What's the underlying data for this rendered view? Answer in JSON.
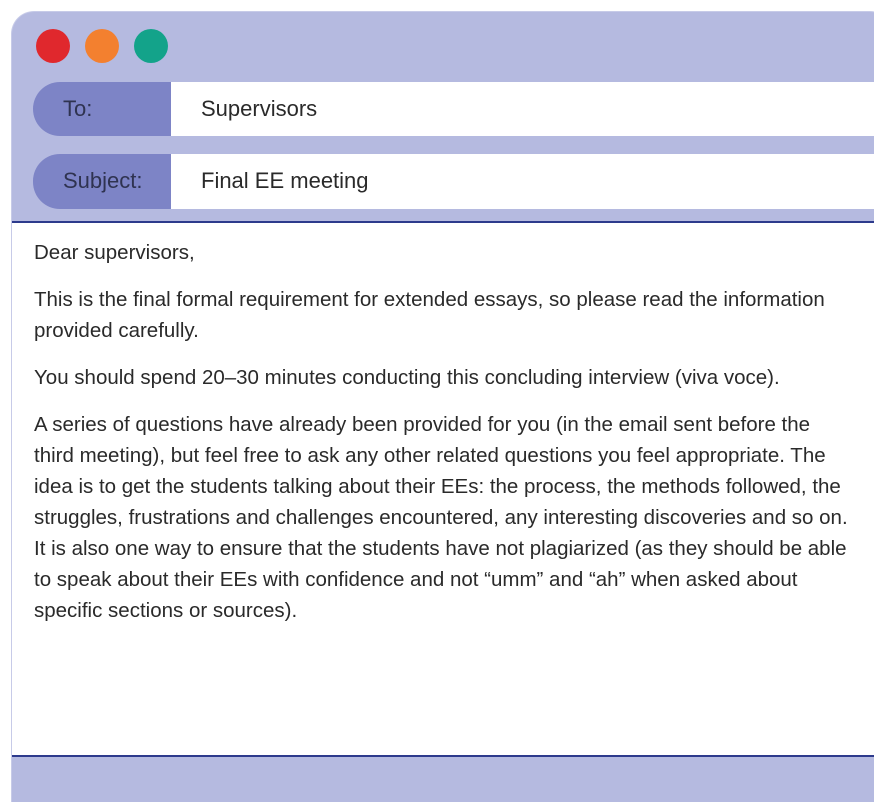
{
  "window": {
    "controls": {
      "close_color": "#e0282d",
      "minimize_color": "#f3802f",
      "maximize_color": "#13a38a"
    }
  },
  "email": {
    "to_label": "To:",
    "to_value": "Supervisors",
    "subject_label": "Subject:",
    "subject_value": "Final EE meeting",
    "body": {
      "greeting": "Dear supervisors,",
      "paragraph_1": "This is the final formal requirement for extended essays, so please read the information provided carefully.",
      "paragraph_2": "You should spend 20–30 minutes conducting this concluding interview (viva voce).",
      "paragraph_3": "A series of questions have already been provided for you (in the email sent before the third meeting), but feel free to ask any other related questions you feel appropriate. The idea is to get the students talking about their EEs: the process, the methods followed, the struggles, frustrations and challenges encountered, any interesting discoveries and so on. It is also one way to ensure that the students have not plagiarized (as they should be able to speak about their EEs with confidence and not “umm” and “ah” when asked about specific sections or sources)."
    }
  },
  "colors": {
    "frame": "#b5bae0",
    "label_bg": "#7d84c6",
    "divider": "#2d3a8c"
  }
}
